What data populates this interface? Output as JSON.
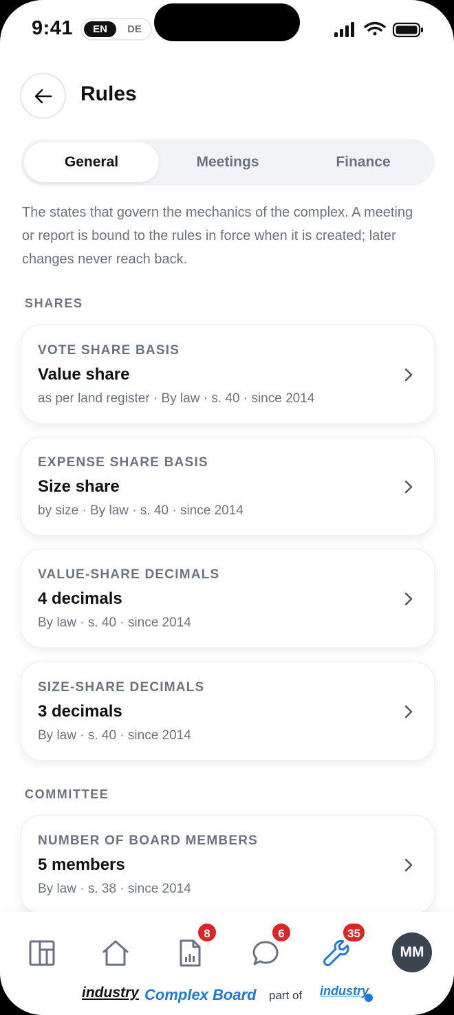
{
  "status_bar": {
    "time": "9:41",
    "lang_active": "EN",
    "lang_inactive": "DE"
  },
  "header": {
    "title": "Rules"
  },
  "tabs": [
    {
      "label": "General",
      "active": true
    },
    {
      "label": "Meetings",
      "active": false
    },
    {
      "label": "Finance",
      "active": false
    }
  ],
  "intro": "The states that govern the mechanics of the complex. A meeting or report is bound to the rules in force when it is created; later changes never reach back.",
  "sections": [
    {
      "title": "SHARES",
      "rules": [
        {
          "label": "VOTE SHARE BASIS",
          "value": "Value share",
          "meta": "as per land register · By law · s. 40 · since 2014"
        },
        {
          "label": "EXPENSE SHARE BASIS",
          "value": "Size share",
          "meta": "by size · By law · s. 40 · since 2014"
        },
        {
          "label": "VALUE-SHARE DECIMALS",
          "value": "4 decimals",
          "meta": "By law · s. 40 · since 2014"
        },
        {
          "label": "SIZE-SHARE DECIMALS",
          "value": "3 decimals",
          "meta": "By law · s. 40 · since 2014"
        }
      ]
    },
    {
      "title": "COMMITTEE",
      "rules": [
        {
          "label": "NUMBER OF BOARD MEMBERS",
          "value": "5 members",
          "meta": "By law · s. 38 · since 2014"
        }
      ]
    }
  ],
  "bottom_nav": {
    "items": [
      {
        "icon": "dashboard-icon"
      },
      {
        "icon": "home-icon"
      },
      {
        "icon": "report-icon",
        "badge": "8"
      },
      {
        "icon": "chat-icon",
        "badge": "6"
      },
      {
        "icon": "wrench-icon",
        "badge": "35",
        "active": true
      }
    ],
    "avatar_initials": "MM"
  },
  "footer": {
    "brand": "industry",
    "product": "Complex Board",
    "part_of": "part of",
    "parent_brand": "industry"
  },
  "colors": {
    "accent": "#1f7ad6",
    "badge": "#dc2626",
    "text_muted": "#6b7280"
  }
}
